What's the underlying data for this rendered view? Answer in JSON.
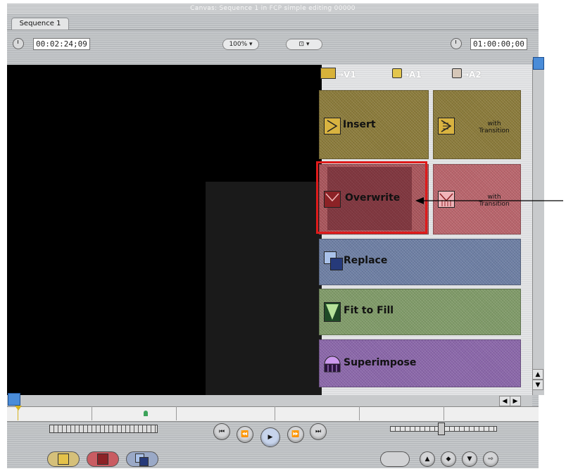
{
  "window": {
    "title": "Canvas: Sequence 1 in FCP simple editing 00000",
    "tab": "Sequence 1"
  },
  "toolbar": {
    "duration_timecode": "00:02:24;09",
    "zoom_label": "100%",
    "view_label": "",
    "current_timecode": "01:00:00;00"
  },
  "tracks": {
    "video": "→V1",
    "audio1": "→A1",
    "audio2": "→A2"
  },
  "edit_overlay": {
    "insert": "Insert",
    "insert_with_transition": "with Transition",
    "overwrite": "Overwrite",
    "overwrite_with_transition": "with Transition",
    "replace": "Replace",
    "fit_to_fill": "Fit to Fill",
    "superimpose": "Superimpose"
  },
  "colors": {
    "insert": "#8a7a3a",
    "overwrite": "#a8545a",
    "replace": "#6d7ea3",
    "fit_to_fill": "#7f9a68",
    "superimpose": "#8a66a9",
    "highlight": "#e01b1b"
  },
  "icons": {
    "scroll_up": "▲",
    "scroll_down": "▼",
    "scroll_left": "◀",
    "scroll_right": "▶"
  }
}
